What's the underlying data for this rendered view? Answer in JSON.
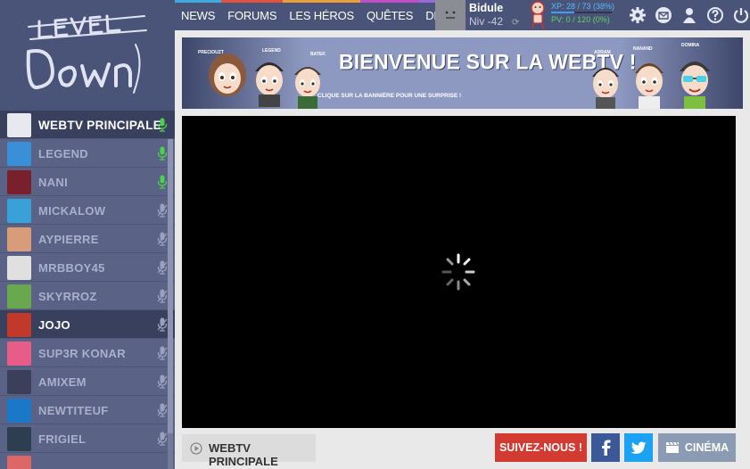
{
  "logo": {
    "text": "LEVEL DOWN"
  },
  "nav": [
    {
      "label": "NEWS",
      "color": "#3fa9e0"
    },
    {
      "label": "FORUMS",
      "color": "#e0523f"
    },
    {
      "label": "LES HÉROS",
      "color": "#e8a13a"
    },
    {
      "label": "QUÊTES",
      "color": "#c04ec7"
    },
    {
      "label": "DLC",
      "color": "#9b6ad6"
    }
  ],
  "user": {
    "name": "Bidule",
    "level": "Niv -42",
    "xp": "XP: 28 / 73 (38%)",
    "xp_fraction": 0.38,
    "pv": "PV: 0 / 120 (0%)"
  },
  "top_icons": [
    "settings-icon",
    "mail-icon",
    "profile-icon",
    "help-icon",
    "power-icon"
  ],
  "banner": {
    "title": "BIENVENUE SUR LA WEBTV !",
    "subtitle": "CLIQUE SUR LA BANNIÈRE POUR UNE SURPRISE !",
    "names_left": [
      "PRECIOUZT",
      "LEGEND",
      "BATEK"
    ],
    "names_right": [
      "ADRAM",
      "NANAND",
      "DOMINA"
    ]
  },
  "channels": [
    {
      "label": "WEBTV PRINCIPALE",
      "mic": "on",
      "color": "#e8e8f0",
      "type": "main"
    },
    {
      "label": "LEGEND",
      "mic": "on",
      "color": "#3a8fd6"
    },
    {
      "label": "NANI",
      "mic": "on",
      "color": "#7a1f2c"
    },
    {
      "label": "MICKALOW",
      "mic": "off",
      "color": "#3aa0d8"
    },
    {
      "label": "AYPIERRE",
      "mic": "off",
      "color": "#d99c7a"
    },
    {
      "label": "MRBBOY45",
      "mic": "off",
      "color": "#e0e0e0"
    },
    {
      "label": "SKYRROZ",
      "mic": "off",
      "color": "#6aa84f"
    },
    {
      "label": "JOJO",
      "mic": "off",
      "color": "#c0392b",
      "active": true
    },
    {
      "label": "SUP3R KONAR",
      "mic": "off",
      "color": "#e85c8a"
    },
    {
      "label": "AMIXEM",
      "mic": "off",
      "color": "#3b3f59"
    },
    {
      "label": "NEWTITEUF",
      "mic": "off",
      "color": "#1b78c8"
    },
    {
      "label": "FRIGIEL",
      "mic": "off",
      "color": "#2c3e50"
    },
    {
      "label": "",
      "mic": "off",
      "color": "#d66"
    }
  ],
  "footer": {
    "tab_label": "WEBTV PRINCIPALE",
    "follow_label": "SUIVEZ-NOUS !",
    "facebook_icon": "facebook-icon",
    "twitter_icon": "twitter-icon",
    "cinema_label": "CINÉMA"
  }
}
